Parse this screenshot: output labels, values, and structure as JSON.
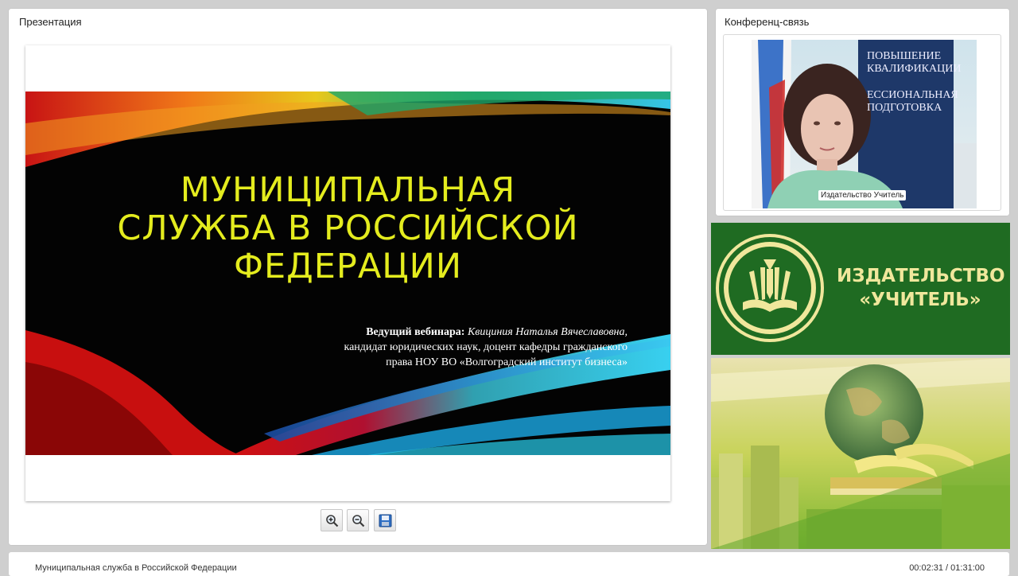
{
  "presentation": {
    "panel_title": "Презентация",
    "slide": {
      "title_lines": [
        "МУНИЦИПАЛЬНАЯ",
        "СЛУЖБА В РОССИЙСКОЙ",
        "ФЕДЕРАЦИИ"
      ],
      "author_label": "Ведущий вебинара:",
      "author_name": "Квициния Наталья Вячеславовна,",
      "author_line2": "кандидат юридических наук, доцент кафедры гражданского",
      "author_line3": "права НОУ ВО «Волгоградский институт бизнеса»",
      "title_color": "#e4ec1e"
    },
    "toolbar": {
      "zoom_in_icon": "zoom-in-icon",
      "zoom_out_icon": "zoom-out-icon",
      "save_icon": "floppy-disk-icon"
    }
  },
  "conference": {
    "panel_title": "Конференц-связь",
    "banner_lines": [
      "ПОВЫШЕНИЕ",
      "КВАЛИФИКАЦИИ",
      "ЕССИОНАЛЬНАЯ",
      "ПОДГОТОВКА"
    ],
    "video_caption": "Издательство Учитель"
  },
  "brand": {
    "line1": "ИЗДАТЕЛЬСТВО",
    "line2": "«УЧИТЕЛЬ»",
    "background": "#1f6b22",
    "text_color": "#f0e79c"
  },
  "footer": {
    "title": "Муниципальная служба в Российской Федерации",
    "time": "00:02:31 / 01:31:00"
  }
}
